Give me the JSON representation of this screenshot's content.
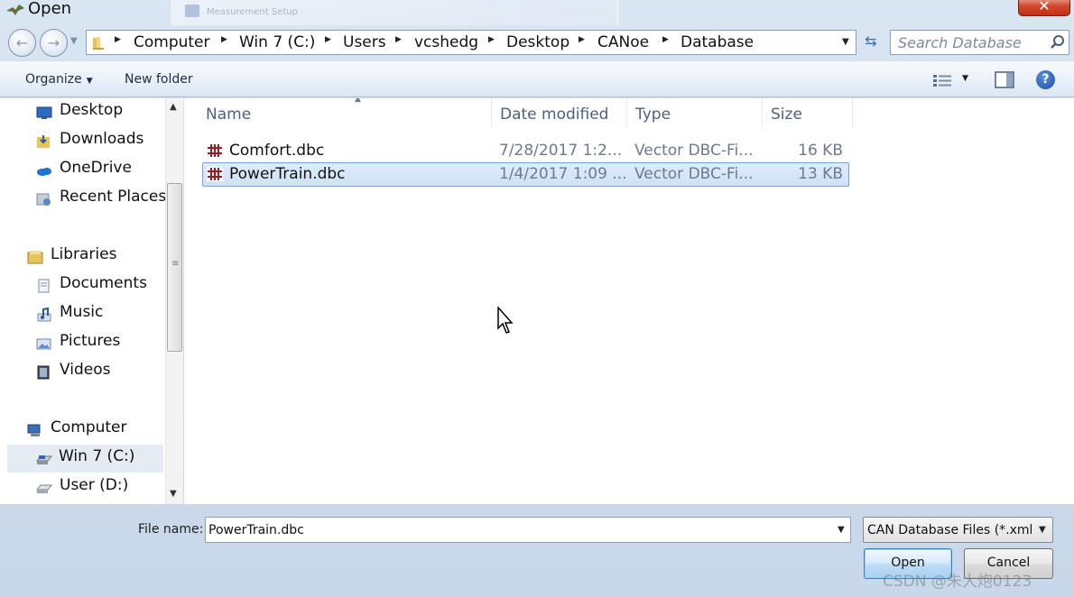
{
  "window": {
    "title": "Open",
    "background_title": "Measurement Setup",
    "close_glyph": "✕"
  },
  "address_bar": {
    "crumbs": [
      "Computer",
      "Win 7 (C:)",
      "Users",
      "vcshedg",
      "Desktop",
      "CANoe",
      "Database"
    ],
    "search_placeholder": "Search Database"
  },
  "toolbar": {
    "organize_label": "Organize",
    "new_folder_label": "New folder",
    "help_glyph": "?"
  },
  "nav_pane": {
    "favorites": [
      {
        "label": "Desktop",
        "icon": "desktop-icon"
      },
      {
        "label": "Downloads",
        "icon": "downloads-icon"
      },
      {
        "label": "OneDrive",
        "icon": "onedrive-icon"
      },
      {
        "label": "Recent Places",
        "icon": "recent-places-icon"
      }
    ],
    "libraries_label": "Libraries",
    "libraries": [
      {
        "label": "Documents",
        "icon": "documents-icon"
      },
      {
        "label": "Music",
        "icon": "music-icon"
      },
      {
        "label": "Pictures",
        "icon": "pictures-icon"
      },
      {
        "label": "Videos",
        "icon": "videos-icon"
      }
    ],
    "computer_label": "Computer",
    "drives": [
      {
        "label": "Win 7 (C:)",
        "icon": "drive-icon",
        "highlighted": true
      },
      {
        "label": "User (D:)",
        "icon": "drive-icon",
        "highlighted": false
      }
    ]
  },
  "file_list": {
    "columns": [
      "Name",
      "Date modified",
      "Type",
      "Size"
    ],
    "rows": [
      {
        "name": "Comfort.dbc",
        "date": "7/28/2017 1:2...",
        "type": "Vector DBC-Fi...",
        "size": "16 KB",
        "selected": false
      },
      {
        "name": "PowerTrain.dbc",
        "date": "1/4/2017 1:09 ...",
        "type": "Vector DBC-Fi...",
        "size": "13 KB",
        "selected": true
      }
    ]
  },
  "bottom": {
    "file_name_label": "File name:",
    "file_name_value": "PowerTrain.dbc",
    "filter_value": "CAN Database Files (*.xml;*.",
    "open_label": "Open",
    "cancel_label": "Cancel"
  },
  "watermark": "CSDN @朱大炮0123",
  "colors": {
    "selection": "#cde1f7",
    "accent": "#3c7fb1",
    "close": "#c12f14"
  }
}
